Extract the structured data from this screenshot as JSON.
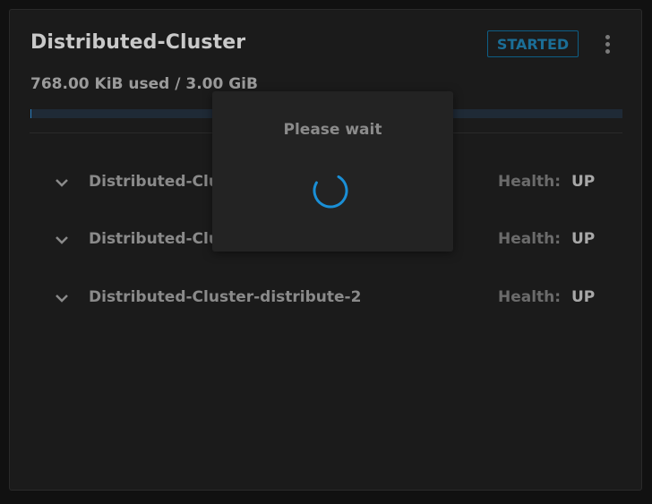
{
  "cluster": {
    "title": "Distributed-Cluster",
    "status": "STARTED",
    "usage_text": "768.00 KiB used / 3.00 GiB",
    "usage_fraction": 0.00024,
    "menu_icon": "kebab-menu-icon"
  },
  "nodes": [
    {
      "name": "Distributed-Clu",
      "health_label": "Health:",
      "health": "UP"
    },
    {
      "name": "Distributed-Clu",
      "health_label": "Health:",
      "health": "UP"
    },
    {
      "name": "Distributed-Cluster-distribute-2",
      "health_label": "Health:",
      "health": "UP"
    }
  ],
  "modal": {
    "title": "Please wait",
    "icon": "loading-spinner-icon"
  },
  "colors": {
    "accent": "#1a8fd6",
    "status_border": "#0e5f86",
    "background": "#1b1b1b"
  }
}
